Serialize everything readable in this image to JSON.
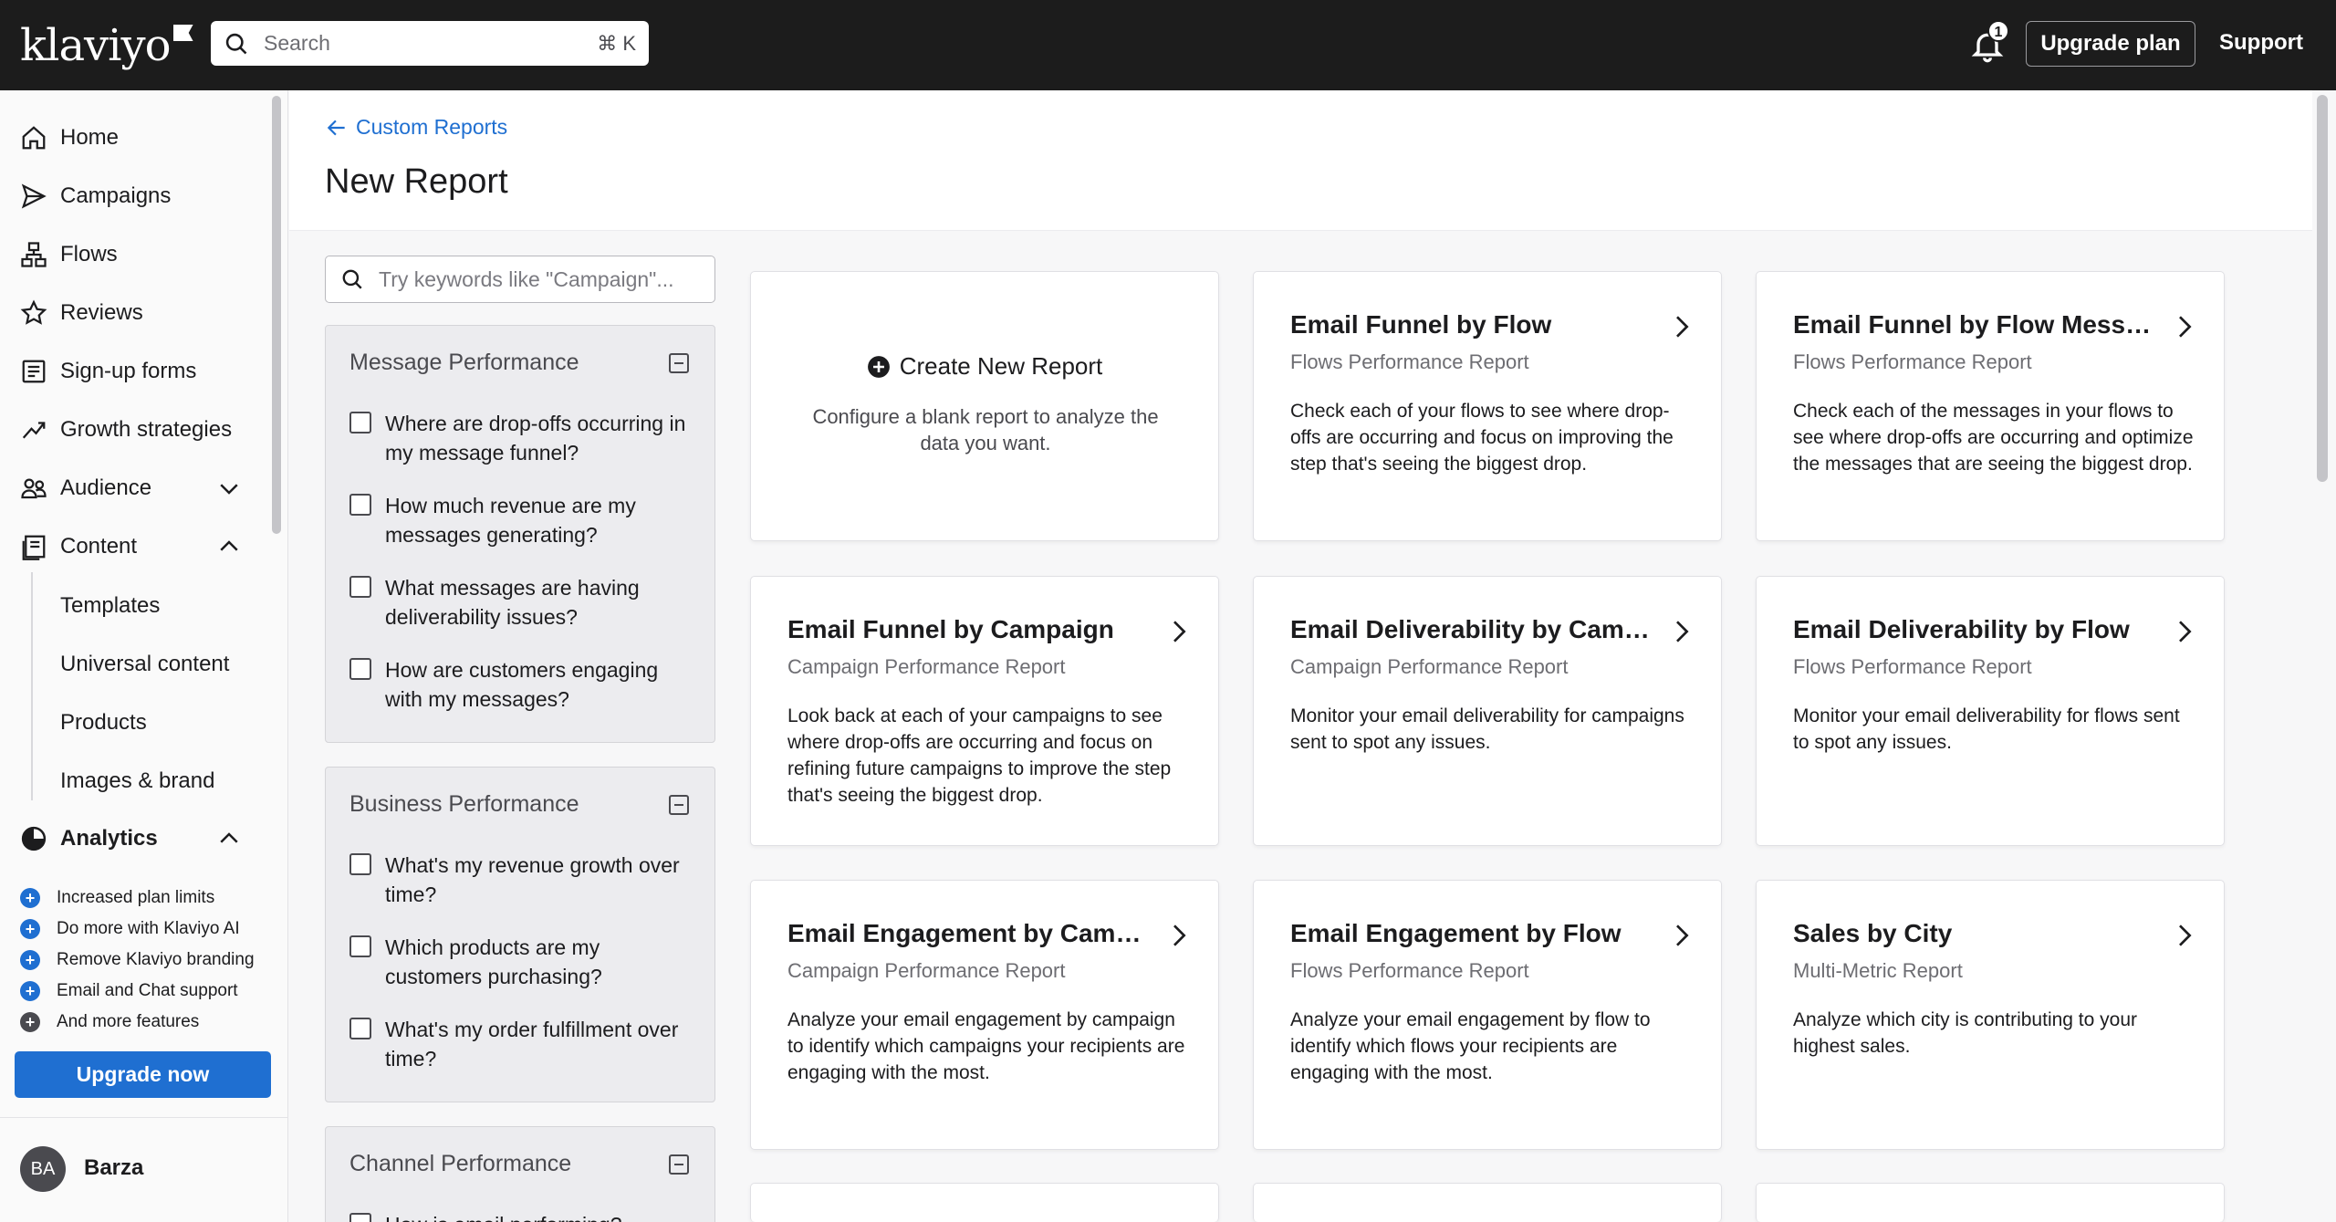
{
  "app": {
    "logo": "klaviyo",
    "search_placeholder": "Search",
    "search_shortcut": "⌘ K",
    "notification_count": "1",
    "upgrade_plan": "Upgrade plan",
    "support": "Support"
  },
  "sidebar": {
    "items": [
      {
        "label": "Home",
        "icon": "home-icon"
      },
      {
        "label": "Campaigns",
        "icon": "send-icon"
      },
      {
        "label": "Flows",
        "icon": "flow-icon"
      },
      {
        "label": "Reviews",
        "icon": "star-icon"
      },
      {
        "label": "Sign-up forms",
        "icon": "form-icon"
      },
      {
        "label": "Growth strategies",
        "icon": "trend-icon"
      },
      {
        "label": "Audience",
        "icon": "users-icon"
      },
      {
        "label": "Content",
        "icon": "content-icon"
      },
      {
        "label": "Analytics",
        "icon": "pie-chart-icon"
      }
    ],
    "content_sub": [
      "Templates",
      "Universal content",
      "Products",
      "Images & brand"
    ],
    "benefits": [
      "Increased plan limits",
      "Do more with Klaviyo AI",
      "Remove Klaviyo branding",
      "Email and Chat support",
      "And more features"
    ],
    "upgrade_now": "Upgrade now",
    "user_initials": "BA",
    "user_name": "Barza"
  },
  "page": {
    "breadcrumb": "Custom Reports",
    "title": "New Report",
    "filter_placeholder": "Try keywords like \"Campaign\"..."
  },
  "filters": [
    {
      "title": "Message Performance",
      "items": [
        "Where are drop-offs occurring in my message funnel?",
        "How much revenue are my messages generating?",
        "What messages are having deliverability issues?",
        "How are customers engaging with my messages?"
      ]
    },
    {
      "title": "Business Performance",
      "items": [
        "What's my revenue growth over time?",
        "Which products are my customers purchasing?",
        "What's my order fulfillment over time?"
      ]
    },
    {
      "title": "Channel Performance",
      "items": [
        "How is email performing?"
      ]
    }
  ],
  "create_card": {
    "title": "Create New Report",
    "desc": "Configure a blank report to analyze the data you want."
  },
  "cards": [
    {
      "title": "Email Funnel by Flow",
      "sub": "Flows Performance Report",
      "desc": "Check each of your flows to see where drop-offs are occurring and focus on improving the step that's seeing the biggest drop."
    },
    {
      "title": "Email Funnel by Flow Message",
      "sub": "Flows Performance Report",
      "desc": "Check each of the messages in your flows to see where drop-offs are occurring and optimize the messages that are seeing the biggest drop."
    },
    {
      "title": "Email Funnel by Campaign",
      "sub": "Campaign Performance Report",
      "desc": "Look back at each of your campaigns to see where drop-offs are occurring and focus on refining future campaigns to improve the step that's seeing the biggest drop."
    },
    {
      "title": "Email Deliverability by Campaign",
      "sub": "Campaign Performance Report",
      "desc": "Monitor your email deliverability for campaigns sent to spot any issues."
    },
    {
      "title": "Email Deliverability by Flow",
      "sub": "Flows Performance Report",
      "desc": "Monitor your email deliverability for flows sent to spot any issues."
    },
    {
      "title": "Email Engagement by Campaign",
      "sub": "Campaign Performance Report",
      "desc": "Analyze your email engagement by campaign to identify which campaigns your recipients are engaging with the most."
    },
    {
      "title": "Email Engagement by Flow",
      "sub": "Flows Performance Report",
      "desc": "Analyze your email engagement by flow to identify which flows your recipients are engaging with the most."
    },
    {
      "title": "Sales by City",
      "sub": "Multi-Metric Report",
      "desc": "Analyze which city is contributing to your highest sales."
    }
  ]
}
